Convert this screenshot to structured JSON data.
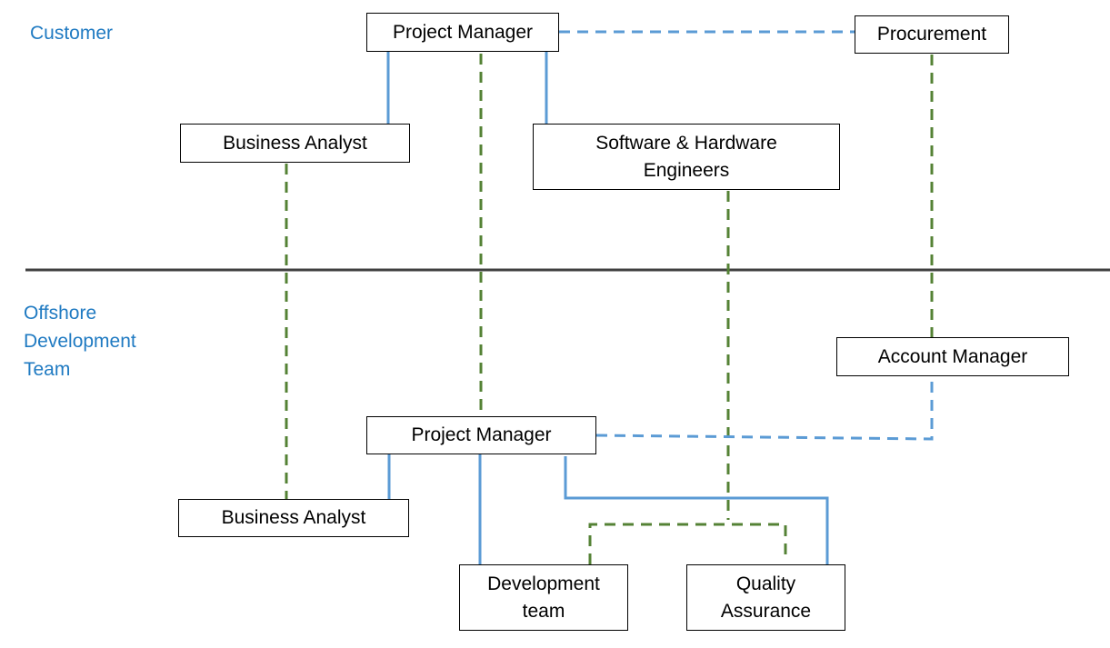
{
  "colors": {
    "section_label": "#1f7ac2",
    "reporting_line": "#5b9bd5",
    "counterpart_line": "#548235",
    "divider": "#404040"
  },
  "sections": {
    "customer": "Customer",
    "offshore": [
      "Offshore",
      "Development",
      "Team"
    ]
  },
  "customer_nodes": {
    "project_manager": "Project Manager",
    "procurement": "Procurement",
    "business_analyst": "Business Analyst",
    "engineers": [
      "Software & Hardware",
      "Engineers"
    ]
  },
  "offshore_nodes": {
    "account_manager": "Account Manager",
    "project_manager": "Project Manager",
    "business_analyst": "Business Analyst",
    "development_team": [
      "Development",
      "team"
    ],
    "quality_assurance": [
      "Quality",
      "Assurance"
    ]
  },
  "connections": [
    {
      "from": "customer.project_manager",
      "to": "customer.business_analyst",
      "style": "solid-blue"
    },
    {
      "from": "customer.project_manager",
      "to": "customer.engineers",
      "style": "solid-blue"
    },
    {
      "from": "customer.project_manager",
      "to": "customer.procurement",
      "style": "dashed-blue"
    },
    {
      "from": "customer.procurement",
      "to": "offshore.account_manager",
      "style": "dashed-green"
    },
    {
      "from": "customer.business_analyst",
      "to": "offshore.business_analyst",
      "style": "dashed-green"
    },
    {
      "from": "customer.project_manager",
      "to": "offshore.project_manager",
      "style": "dashed-green"
    },
    {
      "from": "customer.engineers",
      "to": "offshore.development_team",
      "style": "dashed-green"
    },
    {
      "from": "customer.engineers",
      "to": "offshore.quality_assurance",
      "style": "dashed-green"
    },
    {
      "from": "offshore.account_manager",
      "to": "offshore.project_manager",
      "style": "dashed-blue"
    },
    {
      "from": "offshore.project_manager",
      "to": "offshore.business_analyst",
      "style": "solid-blue"
    },
    {
      "from": "offshore.project_manager",
      "to": "offshore.development_team",
      "style": "solid-blue"
    },
    {
      "from": "offshore.project_manager",
      "to": "offshore.quality_assurance",
      "style": "solid-blue"
    }
  ]
}
